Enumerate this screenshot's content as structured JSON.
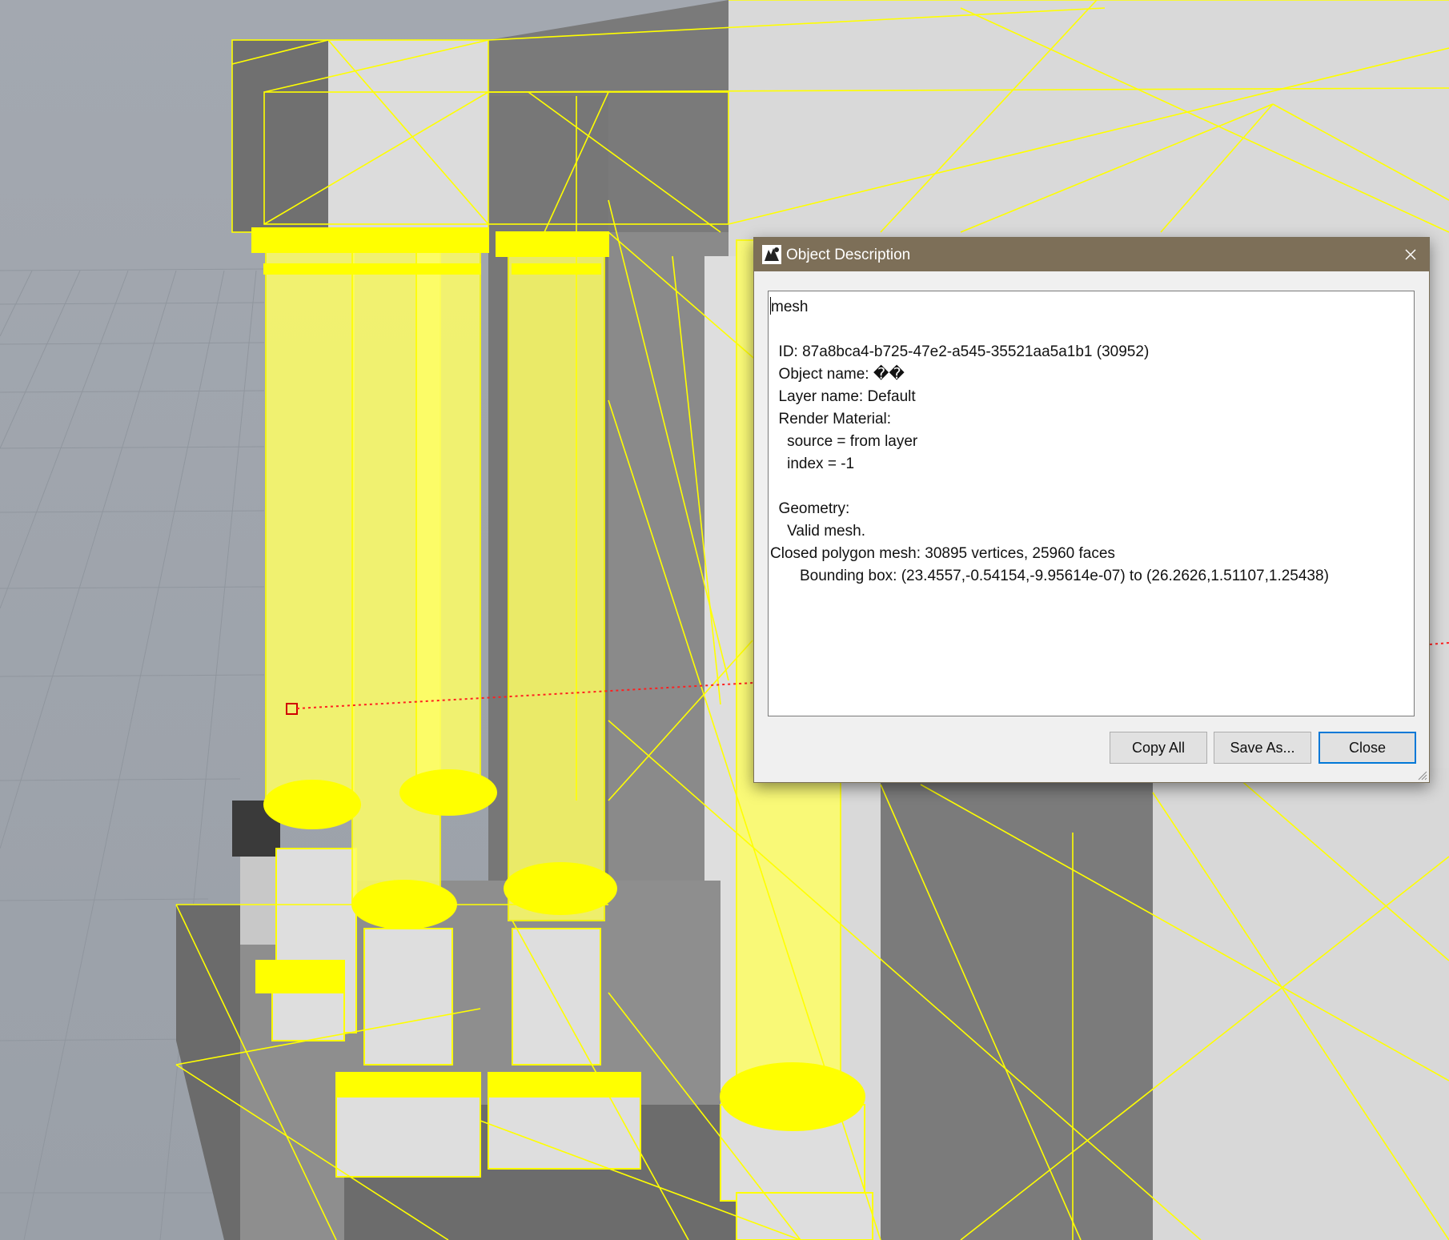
{
  "dialog": {
    "title": "Object Description",
    "lines": [
      "mesh",
      "",
      "  ID: 87a8bca4-b725-47e2-a545-35521aa5a1b1 (30952)",
      "  Object name: ��",
      "  Layer name: Default",
      "  Render Material:",
      "    source = from layer",
      "    index = -1",
      "",
      "  Geometry:",
      "    Valid mesh.",
      "Closed polygon mesh: 30895 vertices, 25960 faces",
      "       Bounding box: (23.4557,-0.54154,-9.95614e-07) to (26.2626,1.51107,1.25438)"
    ],
    "buttons": {
      "copy_all": "Copy All",
      "save_as": "Save As...",
      "close": "Close"
    }
  },
  "colors": {
    "titlebar": "#7d6f58",
    "wireframe": "#ffff00",
    "focus": "#0078d7"
  },
  "icons": {
    "app": "rhino-app-icon",
    "close": "close-icon"
  }
}
